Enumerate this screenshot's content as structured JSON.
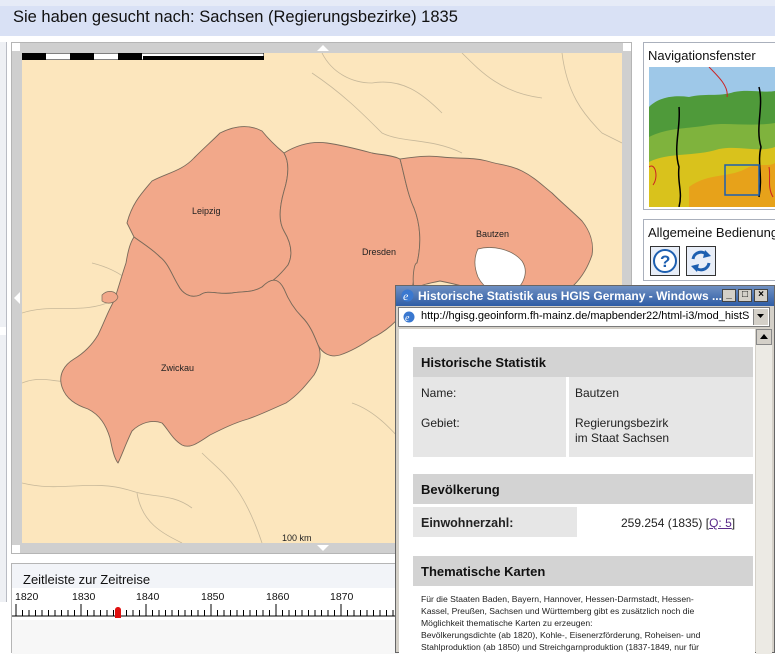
{
  "header": {
    "title": "Sie haben gesucht nach: Sachsen (Regierungsbezirke) 1835"
  },
  "map": {
    "regions": [
      "Leipzig",
      "Dresden",
      "Bautzen",
      "Zwickau"
    ],
    "scale_label": "100 km",
    "colors": {
      "background": "#fce6bd",
      "region_fill": "#f2a88a",
      "border": "#7a6a5a"
    }
  },
  "nav_panel": {
    "title": "Navigationsfenster"
  },
  "general_panel": {
    "title": "Allgemeine Bedienung",
    "help_icon": "question-icon",
    "refresh_icon": "refresh-icon"
  },
  "timeline": {
    "title": "Zeitleiste zur Zeitreise",
    "years": [
      "1820",
      "1830",
      "1840",
      "1850",
      "1860",
      "1870"
    ],
    "marker_year": 1835
  },
  "popup": {
    "window_title": "Historische Statistik aus HGIS Germany - Windows ...",
    "address": "http://hgisg.geoinform.fh-mainz.de/mapbender22/html-i3/mod_histS",
    "buttons": {
      "minimize": "_",
      "maximize": "□",
      "close": "×"
    },
    "section1": {
      "heading": "Historische Statistik",
      "name_label": "Name:",
      "name_value": "Bautzen",
      "area_label": "Gebiet:",
      "area_value_1": "Regierungsbezirk",
      "area_value_2": "im Staat Sachsen"
    },
    "section2": {
      "heading": "Bevölkerung",
      "pop_label": "Einwohnerzahl:",
      "pop_value": "259.254 (1835) [",
      "pop_link": "Q: 5",
      "pop_close": "]"
    },
    "section3": {
      "heading": "Thematische Karten",
      "line1": "Für die Staaten Baden, Bayern, Hannover, Hessen-Darmstadt, Hessen-",
      "line2": "Kassel, Preußen, Sachsen und Württemberg gibt es zusätzlich noch die",
      "line3": "Möglichkeit thematische Karten zu erzeugen:",
      "line4": "Bevölkerungsdichte (ab 1820), Kohle-, Eisenerzförderung, Roheisen- und",
      "line5": "Stahlproduktion (ab 1850) und Streichgarnproduktion (1837-1849, nur für"
    }
  }
}
